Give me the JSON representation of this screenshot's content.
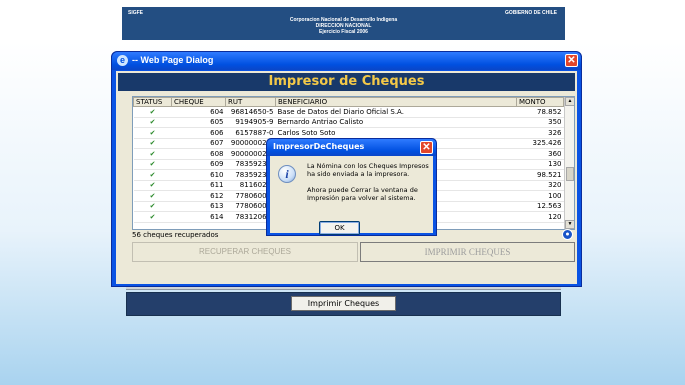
{
  "app": {
    "header_left": "SIGFE",
    "header_right": "GOBIERNO DE CHILE",
    "header_line1": "Corporacion Nacional de Desarrollo Indigena",
    "header_line2": "DIRECCION NACIONAL",
    "header_line3": "Ejercicio Fiscal 2006",
    "print_button": "Imprimir Cheques"
  },
  "dialog": {
    "title": "-- Web Page Dialog",
    "heading": "Impresor de Cheques",
    "columns": [
      "STATUS",
      "CHEQUE",
      "RUT",
      "BENEFICIARIO",
      "MONTO"
    ],
    "rows": [
      {
        "cheque": "604",
        "rut": "96814650-5",
        "beneficiario": "Base de Datos del Diario Oficial S.A.",
        "monto": "78.852"
      },
      {
        "cheque": "605",
        "rut": "9194905-9",
        "beneficiario": "Bernardo Antriao Calisto",
        "monto": "350"
      },
      {
        "cheque": "606",
        "rut": "6157887-0",
        "beneficiario": "Carlos Soto Soto",
        "monto": "326"
      },
      {
        "cheque": "607",
        "rut": "900000029-",
        "beneficiario": "",
        "monto": "325.426"
      },
      {
        "cheque": "608",
        "rut": "900000029-",
        "beneficiario": "",
        "monto": "360"
      },
      {
        "cheque": "609",
        "rut": "78359230-",
        "beneficiario": "",
        "monto": "130"
      },
      {
        "cheque": "610",
        "rut": "78359230-",
        "beneficiario": "",
        "monto": "98.521"
      },
      {
        "cheque": "611",
        "rut": "8116024-",
        "beneficiario": "",
        "monto": "320"
      },
      {
        "cheque": "612",
        "rut": "77806000-",
        "beneficiario": "",
        "monto": "100"
      },
      {
        "cheque": "613",
        "rut": "77806000-",
        "beneficiario": "",
        "monto": "12.563"
      },
      {
        "cheque": "614",
        "rut": "78312060-",
        "beneficiario": "",
        "monto": "120"
      }
    ],
    "status_text": "56 cheques recuperados",
    "recover_button": "RECUPERAR CHEQUES",
    "print_button": "IMPRIMIR CHEQUES"
  },
  "message": {
    "title": "ImpresorDeCheques",
    "line1": "La Nómina con los Cheques Impresos ha sido enviada a la impresora.",
    "line2": "Ahora puede Cerrar la ventana de Impresión para volver al sistema.",
    "ok_label": "OK",
    "icon": "info-icon"
  }
}
